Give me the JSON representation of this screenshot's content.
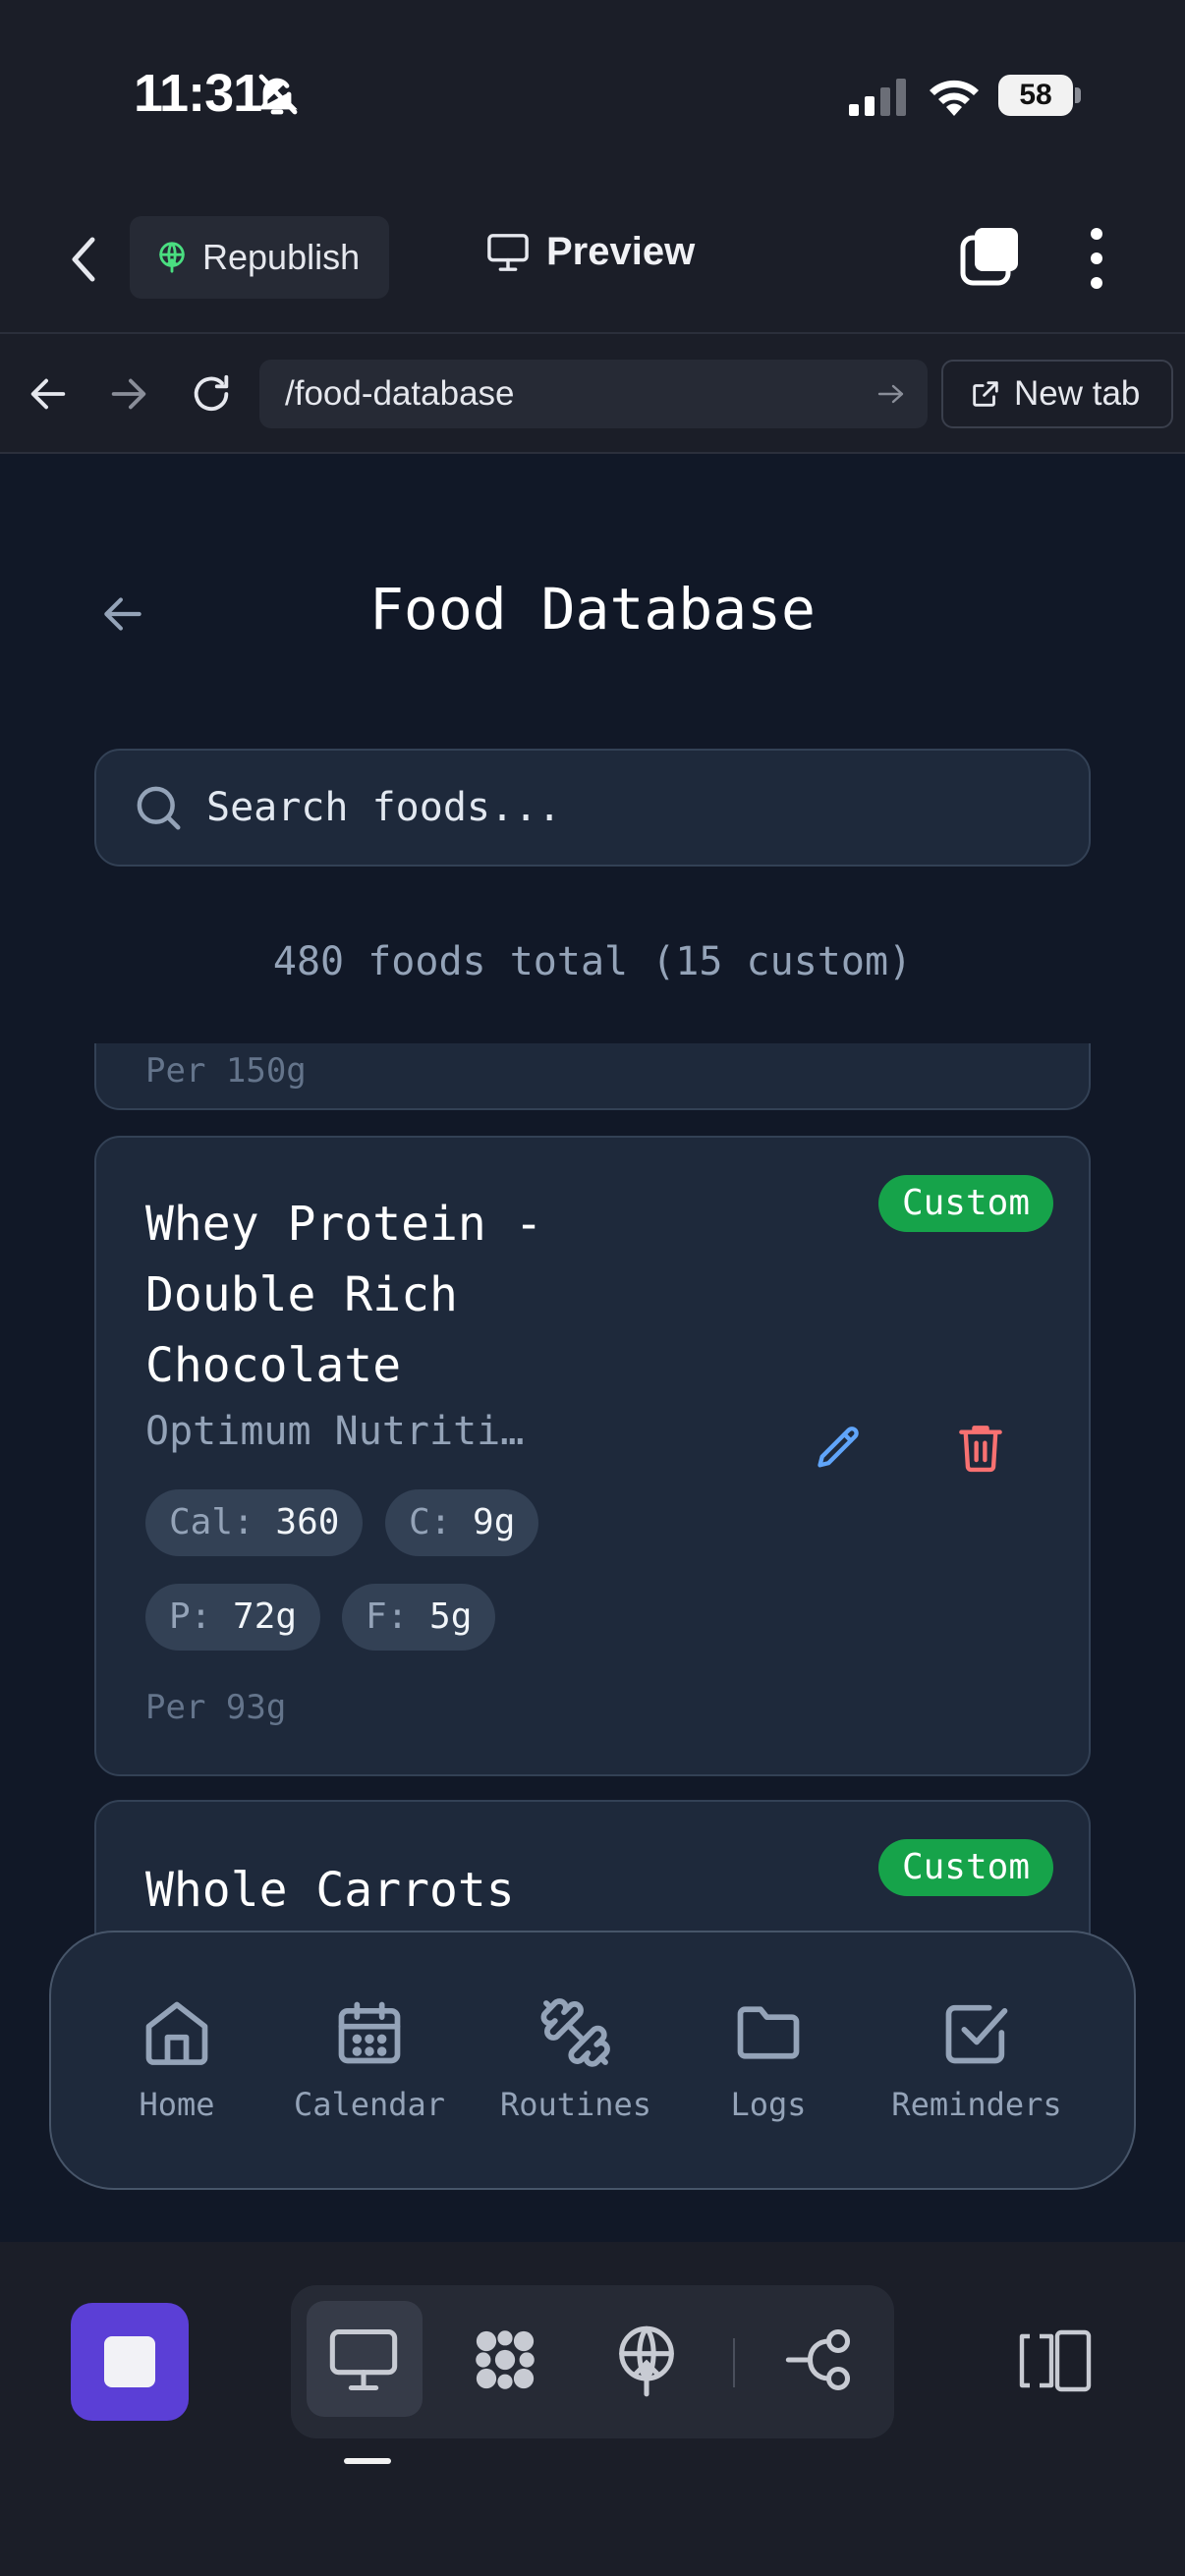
{
  "status_bar": {
    "time": "11:31",
    "battery": "58"
  },
  "toolbar": {
    "republish_label": "Republish",
    "preview_label": "Preview"
  },
  "url_bar": {
    "url": "/food-database",
    "new_tab_label": "New tab"
  },
  "app": {
    "title": "Food Database",
    "search_placeholder": "Search foods...",
    "count_text": "480 foods total (15 custom)",
    "previous_card": {
      "per": "Per 150g"
    },
    "foods": [
      {
        "name": "Whey Protein - Double Rich Chocolate",
        "brand": "Optimum Nutriti…",
        "badge": "Custom",
        "cal_label": "Cal:",
        "cal_value": "360",
        "c_label": "C:",
        "c_value": "9g",
        "p_label": "P:",
        "p_value": "72g",
        "f_label": "F:",
        "f_value": "5g",
        "per": "Per 93g"
      },
      {
        "name": "Whole Carrots",
        "badge": "Custom"
      }
    ]
  },
  "bottom_nav": {
    "items": [
      {
        "label": "Home",
        "icon": "home-icon"
      },
      {
        "label": "Calendar",
        "icon": "calendar-icon"
      },
      {
        "label": "Routines",
        "icon": "dumbbell-icon"
      },
      {
        "label": "Logs",
        "icon": "folder-icon"
      },
      {
        "label": "Reminders",
        "icon": "checkbox-icon"
      }
    ]
  },
  "colors": {
    "app_background": "#111827",
    "card_background": "#1e293b",
    "custom_badge": "#16a34a",
    "edit_icon": "#60a5fa",
    "delete_icon": "#f87171",
    "stop_button": "#5b3fd6"
  }
}
